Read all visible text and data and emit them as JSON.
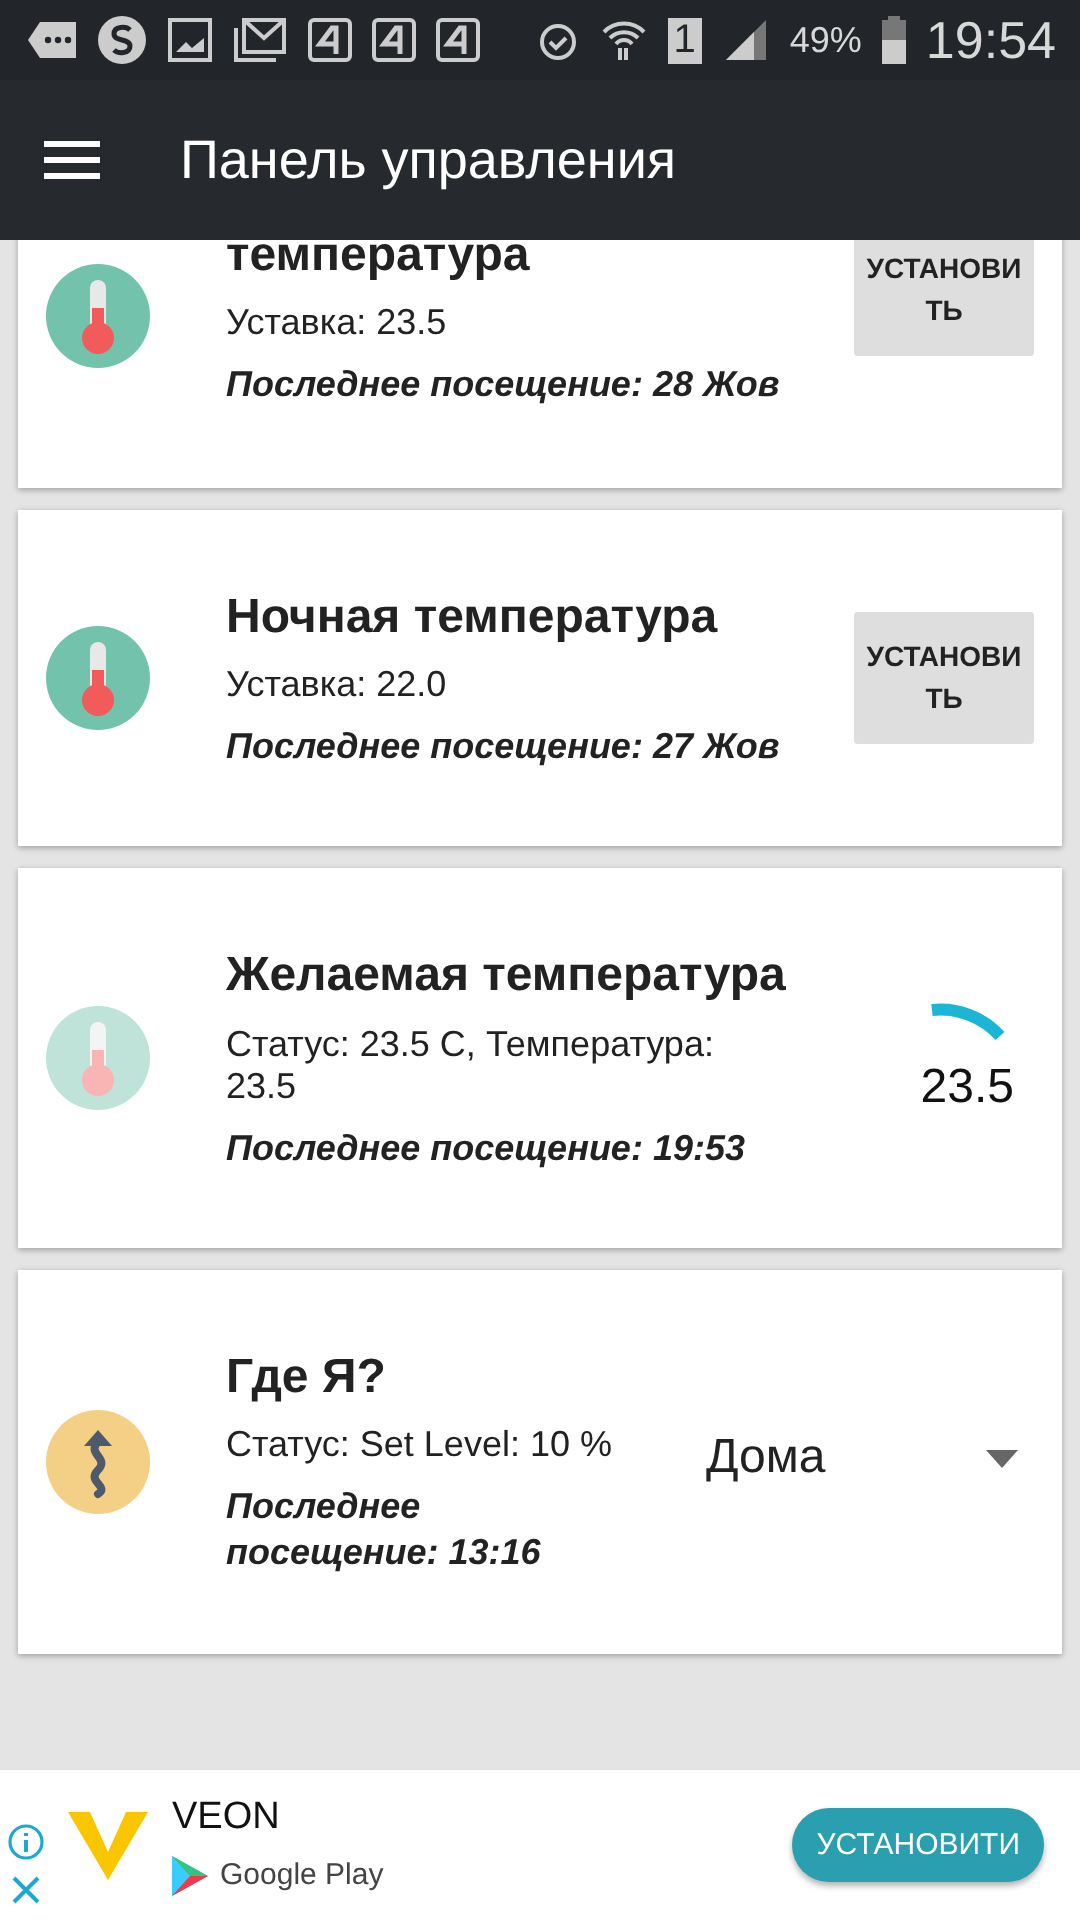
{
  "status_bar": {
    "sim": "1",
    "battery": "49%",
    "time": "19:54"
  },
  "app_bar": {
    "title": "Панель управления"
  },
  "cards": [
    {
      "kind": "button",
      "dimmed": false,
      "title": "температура",
      "status": "Уставка: 23.5",
      "last_visit": "Последнее посещение: 28 Жов",
      "button": "УСТАНОВИТЬ"
    },
    {
      "kind": "button",
      "dimmed": false,
      "title": "Ночная температура",
      "status": "Уставка: 22.0",
      "last_visit": "Последнее посещение: 27 Жов",
      "button": "УСТАНОВИТЬ"
    },
    {
      "kind": "gauge",
      "dimmed": true,
      "title": "Желаемая температура",
      "status": "Статус: 23.5 C, Температура: 23.5",
      "last_visit": "Последнее посещение: 19:53",
      "reading": "23.5"
    },
    {
      "kind": "dropdown",
      "dimmed": false,
      "title": "Где Я?",
      "status": "Статус: Set Level: 10 %",
      "last_visit": "Последнее посещение: 13:16",
      "value": "Дома"
    }
  ],
  "ad": {
    "name": "VEON",
    "store": "Google Play",
    "button": "УСТАНОВИТИ"
  }
}
